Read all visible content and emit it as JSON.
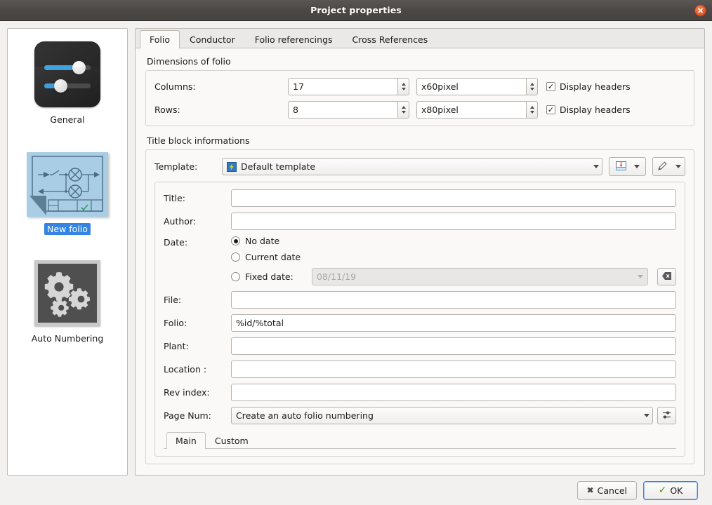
{
  "window": {
    "title": "Project properties",
    "close_icon": "close-icon"
  },
  "sidebar": {
    "items": [
      {
        "label": "General",
        "icon": "sliders-icon",
        "selected": false
      },
      {
        "label": "New folio",
        "icon": "folio-schematic-icon",
        "selected": true
      },
      {
        "label": "Auto Numbering",
        "icon": "gears-icon",
        "selected": false
      }
    ]
  },
  "tabs": [
    {
      "label": "Folio",
      "active": true
    },
    {
      "label": "Conductor",
      "active": false
    },
    {
      "label": "Folio referencings",
      "active": false
    },
    {
      "label": "Cross References",
      "active": false
    }
  ],
  "dimensions": {
    "group_title": "Dimensions of folio",
    "columns": {
      "label": "Columns:",
      "count": "17",
      "size": "x60pixel",
      "display_headers_label": "Display headers",
      "display_headers_checked": true,
      "check_glyph": "✓"
    },
    "rows": {
      "label": "Rows:",
      "count": "8",
      "size": "x80pixel",
      "display_headers_label": "Display headers",
      "display_headers_checked": true,
      "check_glyph": "✓"
    }
  },
  "title_block": {
    "group_title": "Title block informations",
    "template_label": "Template:",
    "template_value": "Default template",
    "template_icon": "lightning-bolt-icon",
    "insert_button_icon": "title-block-insert-icon",
    "edit_button_icon": "pencil-edit-icon",
    "fields": [
      {
        "key": "title",
        "label": "Title:",
        "value": ""
      },
      {
        "key": "author",
        "label": "Author:",
        "value": ""
      }
    ],
    "date": {
      "label": "Date:",
      "options": [
        {
          "label": "No date",
          "selected": true
        },
        {
          "label": "Current date",
          "selected": false
        },
        {
          "label": "Fixed date:",
          "selected": false
        }
      ],
      "fixed_date_value": "08/11/19",
      "fixed_date_enabled": false,
      "clear_button_icon": "backspace-clear-icon"
    },
    "fields2": [
      {
        "key": "file",
        "label": "File:",
        "value": ""
      },
      {
        "key": "folio",
        "label": "Folio:",
        "value": "%id/%total"
      },
      {
        "key": "plant",
        "label": "Plant:",
        "value": ""
      },
      {
        "key": "location",
        "label": "Location :",
        "value": ""
      },
      {
        "key": "rev_index",
        "label": "Rev index:",
        "value": ""
      }
    ],
    "page_num": {
      "label": "Page Num:",
      "value": "Create an auto folio numbering",
      "settings_button_icon": "sliders-settings-icon"
    },
    "inner_tabs": [
      {
        "label": "Main",
        "active": true
      },
      {
        "label": "Custom",
        "active": false
      }
    ]
  },
  "footer": {
    "cancel": {
      "label": "Cancel",
      "icon": "cross-icon",
      "glyph": "✖"
    },
    "ok": {
      "label": "OK",
      "icon": "check-icon",
      "glyph": "✓"
    }
  },
  "colors": {
    "accent": "#3584e4",
    "titlebar": "#4c4845",
    "close_button": "#e2582a",
    "ok_check": "#4e9a06",
    "window_bg": "#f2f1f0",
    "panel_bg": "#faf9f8"
  }
}
